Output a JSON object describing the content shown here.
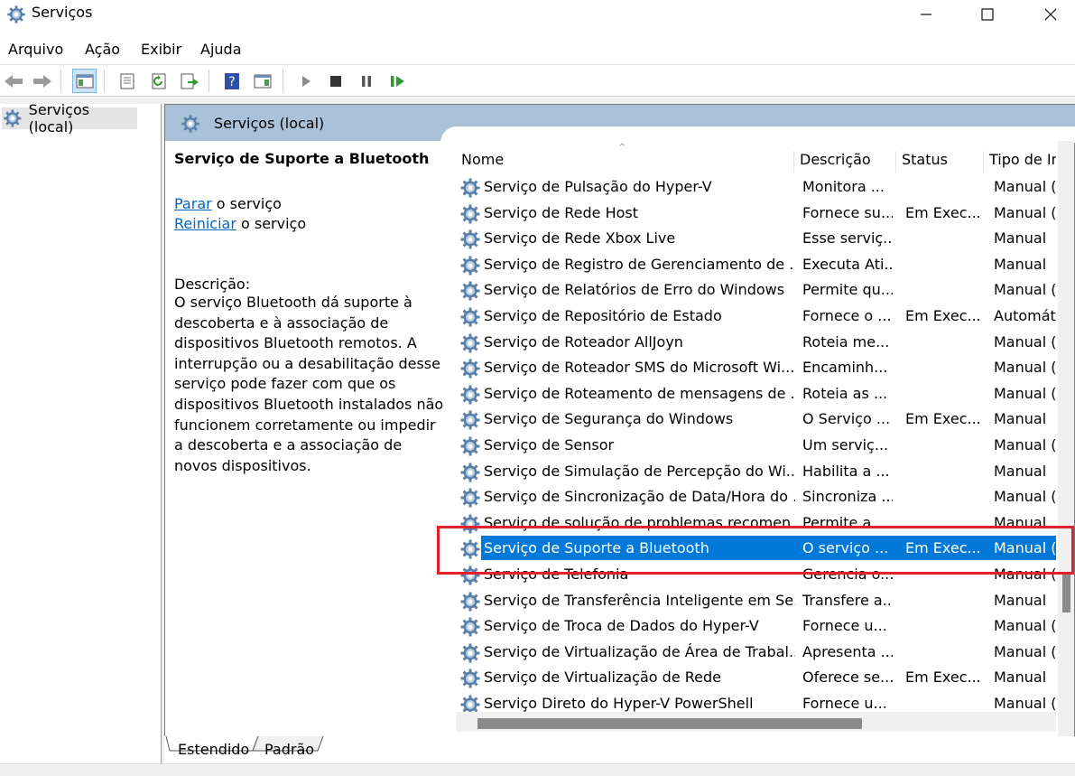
{
  "window": {
    "title": "Serviços"
  },
  "menu": [
    "Arquivo",
    "Ação",
    "Exibir",
    "Ajuda"
  ],
  "tree": {
    "root_label": "Serviços (local)"
  },
  "panel": {
    "header": "Serviços (local)",
    "selected_title": "Serviço de Suporte a Bluetooth",
    "link_stop": "Parar",
    "link_stop_suffix": " o serviço",
    "link_restart": "Reiniciar",
    "link_restart_suffix": " o serviço",
    "description_label": "Descrição:",
    "description_text": "O serviço Bluetooth dá suporte à descoberta e à associação de dispositivos Bluetooth remotos. A interrupção ou a desabilitação desse serviço pode fazer com que os dispositivos Bluetooth instalados não funcionem corretamente ou impedir a descoberta e a associação de novos dispositivos."
  },
  "columns": {
    "name": "Nome",
    "description": "Descrição",
    "status": "Status",
    "startup": "Tipo de In"
  },
  "services": [
    {
      "name": "Serviço de Pulsação do Hyper-V",
      "description": "Monitora ...",
      "status": "",
      "startup": "Manual (l"
    },
    {
      "name": "Serviço de Rede Host",
      "description": "Fornece su...",
      "status": "Em Exec...",
      "startup": "Manual (l"
    },
    {
      "name": "Serviço de Rede Xbox Live",
      "description": "Esse serviç...",
      "status": "",
      "startup": "Manual"
    },
    {
      "name": "Serviço de Registro de Gerenciamento de ...",
      "description": "Executa Ati...",
      "status": "",
      "startup": "Manual"
    },
    {
      "name": "Serviço de Relatórios de Erro do Windows",
      "description": "Permite qu...",
      "status": "",
      "startup": "Manual (l"
    },
    {
      "name": "Serviço de Repositório de Estado",
      "description": "Fornece o ...",
      "status": "Em Exec...",
      "startup": "Automáti"
    },
    {
      "name": "Serviço de Roteador AllJoyn",
      "description": "Roteia me...",
      "status": "",
      "startup": "Manual (l"
    },
    {
      "name": "Serviço de Roteador SMS do Microsoft Wi...",
      "description": "Encaminh...",
      "status": "",
      "startup": "Manual (l"
    },
    {
      "name": "Serviço de Roteamento de mensagens de ...",
      "description": "Roteia as ...",
      "status": "",
      "startup": "Manual (l"
    },
    {
      "name": "Serviço de Segurança do Windows",
      "description": "O Serviço ...",
      "status": "Em Exec...",
      "startup": "Manual"
    },
    {
      "name": "Serviço de Sensor",
      "description": "Um serviç...",
      "status": "",
      "startup": "Manual (l"
    },
    {
      "name": "Serviço de Simulação de Percepção do Wi...",
      "description": "Habilita a ...",
      "status": "",
      "startup": "Manual"
    },
    {
      "name": "Serviço de Sincronização de Data/Hora do ...",
      "description": "Sincroniza ...",
      "status": "",
      "startup": "Manual (l"
    },
    {
      "name": "Serviço de solução de problemas recomen...",
      "description": "Permite a ...",
      "status": "",
      "startup": "Manual"
    },
    {
      "name": "Serviço de Suporte a Bluetooth",
      "description": "O serviço ...",
      "status": "Em Exec...",
      "startup": "Manual (l"
    },
    {
      "name": "Serviço de Telefonia",
      "description": "Gerencia o...",
      "status": "",
      "startup": "Manual (l"
    },
    {
      "name": "Serviço de Transferência Inteligente em Se...",
      "description": "Transfere a...",
      "status": "",
      "startup": "Manual"
    },
    {
      "name": "Serviço de Troca de Dados do Hyper-V",
      "description": "Fornece u...",
      "status": "",
      "startup": "Manual (l"
    },
    {
      "name": "Serviço de Virtualização de Área de Trabal...",
      "description": "Apresenta ...",
      "status": "",
      "startup": "Manual (l"
    },
    {
      "name": "Serviço de Virtualização de Rede",
      "description": "Oferece se...",
      "status": "Em Exec...",
      "startup": "Manual"
    },
    {
      "name": "Serviço Direto do Hyper-V PowerShell",
      "description": "Fornece u...",
      "status": "",
      "startup": "Manual (l"
    }
  ],
  "selected_index": 14,
  "tabs": [
    "Estendido",
    "Padrão"
  ],
  "colors": {
    "selection": "#0078d7",
    "header": "#a9c2d9",
    "link": "#0066cc",
    "highlight_box": "#e3212b"
  }
}
